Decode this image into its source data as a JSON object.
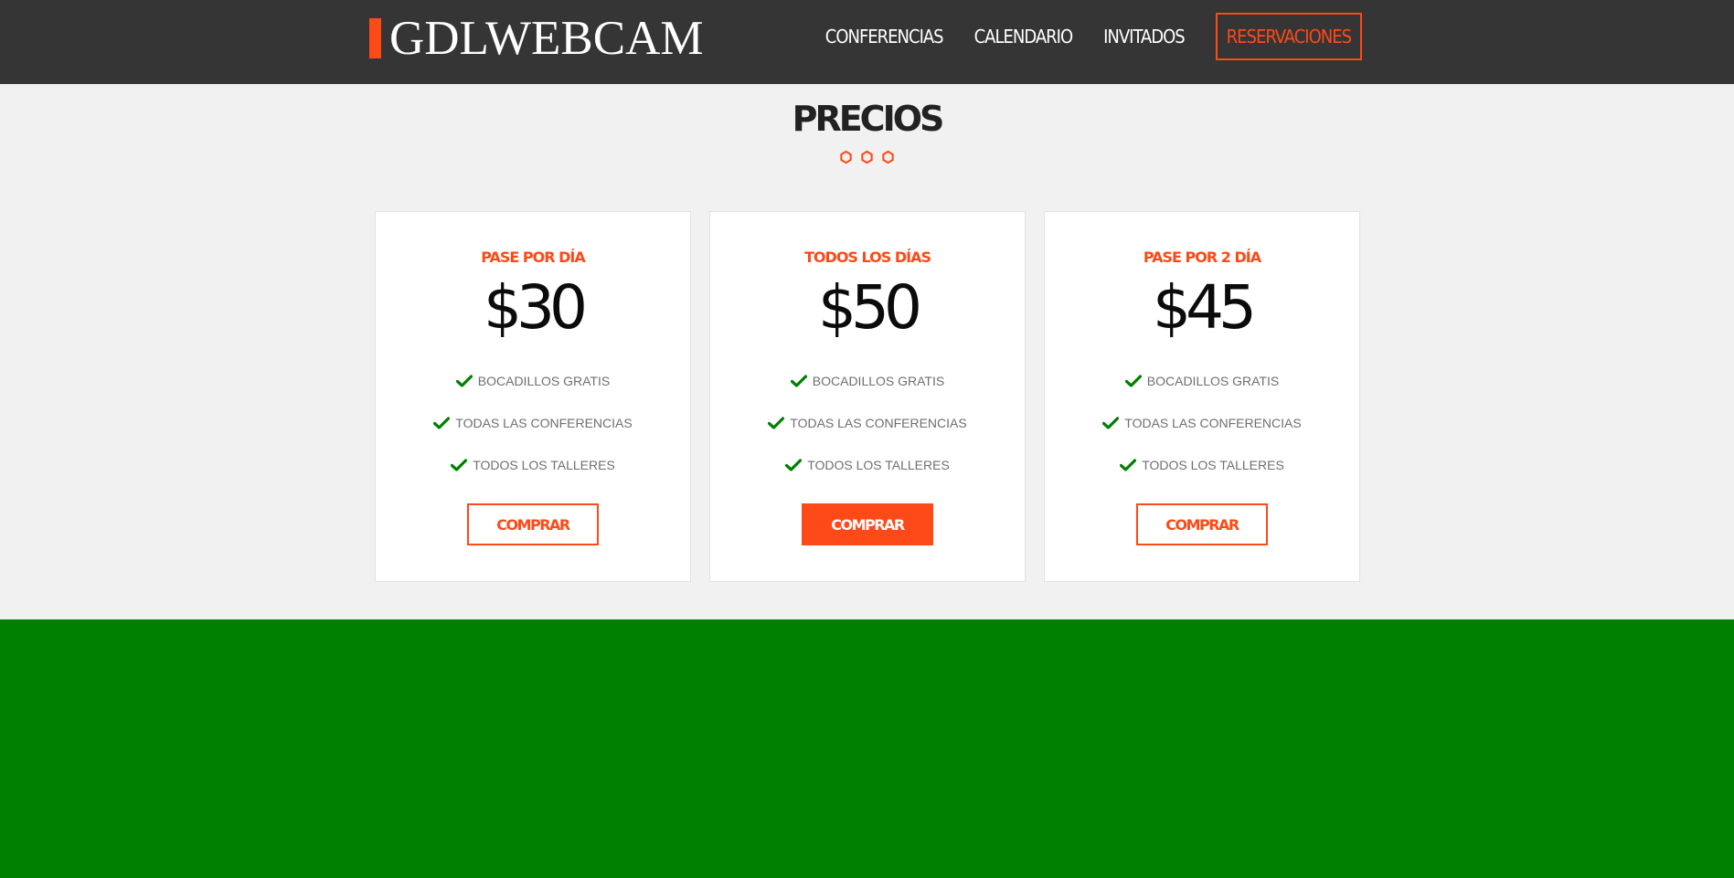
{
  "header": {
    "logo_text": "GDLWEBCAM",
    "nav": [
      {
        "label": "CONFERENCIAS"
      },
      {
        "label": "CALENDARIO"
      },
      {
        "label": "INVITADOS"
      },
      {
        "label": "RESERVACIONES"
      }
    ]
  },
  "section": {
    "title": "PRECIOS"
  },
  "plans": [
    {
      "name": "PASE POR DÍA",
      "price": "$30",
      "features": [
        "BOCADILLOS GRATIS",
        "TODAS LAS CONFERENCIAS",
        "TODOS LOS TALLERES"
      ],
      "button": "COMPRAR",
      "highlighted": false
    },
    {
      "name": "TODOS LOS DÍAS",
      "price": "$50",
      "features": [
        "BOCADILLOS GRATIS",
        "TODAS LAS CONFERENCIAS",
        "TODOS LOS TALLERES"
      ],
      "button": "COMPRAR",
      "highlighted": true
    },
    {
      "name": "PASE POR 2 DÍA",
      "price": "$45",
      "features": [
        "BOCADILLOS GRATIS",
        "TODAS LAS CONFERENCIAS",
        "TODOS LOS TALLERES"
      ],
      "button": "COMPRAR",
      "highlighted": false
    }
  ],
  "colors": {
    "accent": "#fe4918",
    "header_bg": "#353535",
    "check": "#008000",
    "band": "#008000"
  },
  "icons": {
    "logo_mark": "orange-bar",
    "feature": "check-icon",
    "divider": "hexagon-icon"
  }
}
